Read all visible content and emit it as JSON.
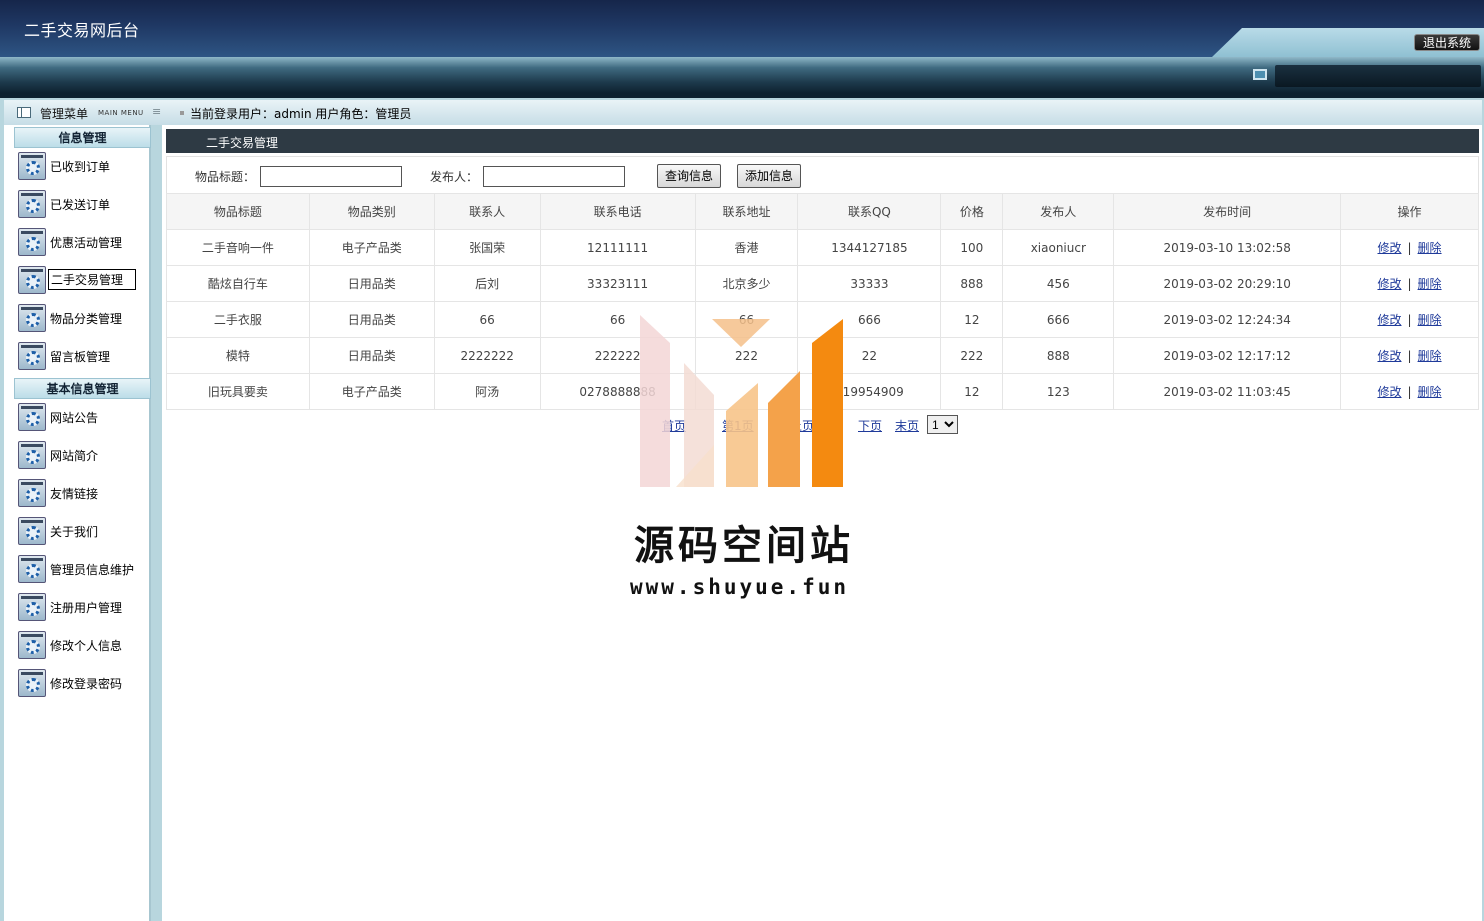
{
  "app": {
    "title": "二手交易网后台",
    "logout_label": "退出系统"
  },
  "sidebar": {
    "header_label": "管理菜单",
    "header_sub": "MAIN MENU",
    "sections": [
      {
        "title": "信息管理",
        "items": [
          "已收到订单",
          "已发送订单",
          "优惠活动管理",
          "二手交易管理",
          "物品分类管理",
          "留言板管理"
        ]
      },
      {
        "title": "基本信息管理",
        "items": [
          "网站公告",
          "网站简介",
          "友情链接",
          "关于我们",
          "管理员信息维护",
          "注册用户管理",
          "修改个人信息",
          "修改登录密码"
        ]
      }
    ],
    "active_item": "二手交易管理"
  },
  "userbar": {
    "text": "当前登录用户：admin  用户角色：管理员"
  },
  "panel": {
    "title": "二手交易管理"
  },
  "filter": {
    "title_label": "物品标题：",
    "title_value": "",
    "publisher_label": "发布人：",
    "publisher_value": "",
    "query_button": "查询信息",
    "add_button": "添加信息"
  },
  "table": {
    "columns": [
      "物品标题",
      "物品类别",
      "联系人",
      "联系电话",
      "联系地址",
      "联系QQ",
      "价格",
      "发布人",
      "发布时间",
      "操作"
    ],
    "rows": [
      [
        "二手音响一件",
        "电子产品类",
        "张国荣",
        "12111111",
        "香港",
        "1344127185",
        "100",
        "xiaoniucr",
        "2019-03-10 13:02:58"
      ],
      [
        "酷炫自行车",
        "日用品类",
        "后刘",
        "33323111",
        "北京多少",
        "33333",
        "888",
        "456",
        "2019-03-02 20:29:10"
      ],
      [
        "二手衣服",
        "日用品类",
        "66",
        "66",
        "66",
        "666",
        "12",
        "666",
        "2019-03-02 12:24:34"
      ],
      [
        "模特",
        "日用品类",
        "2222222",
        "222222",
        "222",
        "22",
        "222",
        "888",
        "2019-03-02 12:17:12"
      ],
      [
        "旧玩具要卖",
        "电子产品类",
        "阿汤",
        "0278888888",
        "",
        "619954909",
        "12",
        "123",
        "2019-03-02 11:03:45"
      ]
    ],
    "edit_label": "修改",
    "delete_label": "删除"
  },
  "pager": {
    "first": "首页",
    "prev": "上页",
    "next": "下页",
    "last": "末页",
    "page_text": "第1页",
    "current_page": "1"
  },
  "watermark": {
    "name": "源码空间站",
    "url": "www.shuyue.fun"
  }
}
